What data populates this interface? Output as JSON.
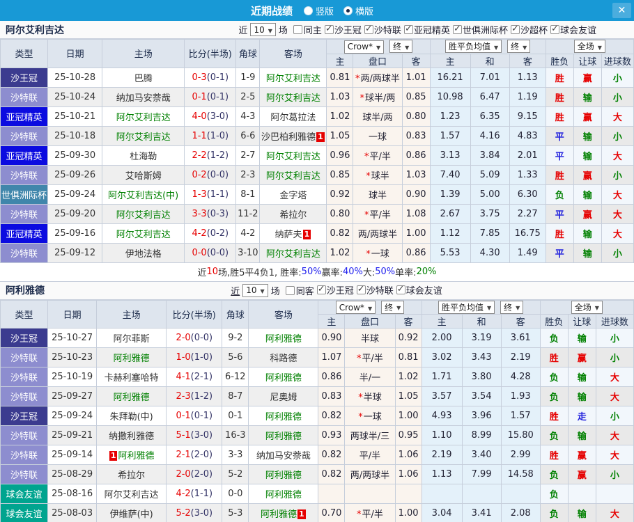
{
  "titlebar": {
    "title": "近期战绩",
    "radios": [
      {
        "label": "竖版",
        "selected": false
      },
      {
        "label": "横版",
        "selected": true
      }
    ],
    "close_icon": "✕",
    "bar_color": "#1899d6"
  },
  "type_colors": {
    "沙王冠": "#3b3b8f",
    "沙特联": "#8d8dcf",
    "亚冠精英": "#0b0be0",
    "世俱洲际杯": "#4086ab",
    "球会友谊": "#00a48f"
  },
  "value_colors": {
    "胜": "#e60000",
    "平": "#2222dd",
    "负": "#008000",
    "赢": "#e60000",
    "输": "#008000",
    "走": "#2222dd",
    "大": "#e60000",
    "小": "#008000"
  },
  "sections": [
    {
      "team": "阿尔艾利吉达",
      "filter": {
        "near": "近",
        "count": "10",
        "games": "场",
        "same": {
          "label": "同主",
          "checked": false
        },
        "leagues": [
          "沙王冠",
          "沙特联",
          "亚冠精英",
          "世俱洲际杯",
          "沙超杯",
          "球会友谊"
        ],
        "near_underline": false
      },
      "dropdowns": {
        "company": "Crow*",
        "final1": "终",
        "avg": "胜平负均值",
        "final2": "终",
        "scope": "全场"
      },
      "columns": [
        "类型",
        "日期",
        "主场",
        "比分(半场)",
        "角球",
        "客场",
        "主",
        "盘口",
        "客",
        "主",
        "和",
        "客",
        "胜负",
        "让球",
        "进球数"
      ],
      "rows": [
        {
          "type": "沙王冠",
          "date": "25-10-28",
          "home": {
            "name": "巴腾",
            "focus": false
          },
          "score": "0-3",
          "half": "(0-1)",
          "corner": "1-9",
          "away": {
            "name": "阿尔艾利吉达",
            "focus": true
          },
          "odds": {
            "h": "0.81",
            "star": true,
            "pan": "两/两球半",
            "a": "1.01"
          },
          "avg": [
            "16.21",
            "7.01",
            "1.13"
          ],
          "result": "胜",
          "hcp": "赢",
          "goals": "小"
        },
        {
          "type": "沙特联",
          "date": "25-10-24",
          "home": {
            "name": "纳加马安萘哉",
            "focus": false
          },
          "score": "0-1",
          "half": "(0-1)",
          "corner": "2-5",
          "away": {
            "name": "阿尔艾利吉达",
            "focus": true
          },
          "odds": {
            "h": "1.03",
            "star": true,
            "pan": "球半/两",
            "a": "0.85"
          },
          "avg": [
            "10.98",
            "6.47",
            "1.19"
          ],
          "result": "胜",
          "hcp": "输",
          "goals": "小"
        },
        {
          "type": "亚冠精英",
          "date": "25-10-21",
          "home": {
            "name": "阿尔艾利吉达",
            "focus": true
          },
          "score": "4-0",
          "half": "(3-0)",
          "corner": "4-3",
          "away": {
            "name": "阿尔葛拉法",
            "focus": false
          },
          "odds": {
            "h": "1.02",
            "star": false,
            "pan": "球半/两",
            "a": "0.80"
          },
          "avg": [
            "1.23",
            "6.35",
            "9.15"
          ],
          "result": "胜",
          "hcp": "赢",
          "goals": "大"
        },
        {
          "type": "沙特联",
          "date": "25-10-18",
          "home": {
            "name": "阿尔艾利吉达",
            "focus": true
          },
          "score": "1-1",
          "half": "(1-0)",
          "corner": "6-6",
          "away": {
            "name": "沙巴柏利雅德",
            "focus": false,
            "card_after": "1"
          },
          "odds": {
            "h": "1.05",
            "star": false,
            "pan": "一球",
            "a": "0.83"
          },
          "avg": [
            "1.57",
            "4.16",
            "4.83"
          ],
          "result": "平",
          "hcp": "输",
          "goals": "小"
        },
        {
          "type": "亚冠精英",
          "date": "25-09-30",
          "home": {
            "name": "杜海勒",
            "focus": false
          },
          "score": "2-2",
          "half": "(1-2)",
          "corner": "2-7",
          "away": {
            "name": "阿尔艾利吉达",
            "focus": true
          },
          "odds": {
            "h": "0.96",
            "star": true,
            "pan": "平/半",
            "a": "0.86"
          },
          "avg": [
            "3.13",
            "3.84",
            "2.01"
          ],
          "result": "平",
          "hcp": "输",
          "goals": "大"
        },
        {
          "type": "沙特联",
          "date": "25-09-26",
          "home": {
            "name": "艾哈斯姆",
            "focus": false
          },
          "score": "0-2",
          "half": "(0-0)",
          "corner": "2-3",
          "away": {
            "name": "阿尔艾利吉达",
            "focus": true
          },
          "odds": {
            "h": "0.85",
            "star": true,
            "pan": "球半",
            "a": "1.03"
          },
          "avg": [
            "7.40",
            "5.09",
            "1.33"
          ],
          "result": "胜",
          "hcp": "赢",
          "goals": "小"
        },
        {
          "type": "世俱洲际杯",
          "date": "25-09-24",
          "home": {
            "name": "阿尔艾利吉达(中)",
            "focus": true
          },
          "score": "1-3",
          "half": "(1-1)",
          "corner": "8-1",
          "away": {
            "name": "金字塔",
            "focus": false
          },
          "odds": {
            "h": "0.92",
            "star": false,
            "pan": "球半",
            "a": "0.90"
          },
          "avg": [
            "1.39",
            "5.00",
            "6.30"
          ],
          "result": "负",
          "hcp": "输",
          "goals": "大"
        },
        {
          "type": "沙特联",
          "date": "25-09-20",
          "home": {
            "name": "阿尔艾利吉达",
            "focus": true
          },
          "score": "3-3",
          "half": "(0-3)",
          "corner": "11-2",
          "away": {
            "name": "希拉尔",
            "focus": false
          },
          "odds": {
            "h": "0.80",
            "star": true,
            "pan": "平/半",
            "a": "1.08"
          },
          "avg": [
            "2.67",
            "3.75",
            "2.27"
          ],
          "result": "平",
          "hcp": "赢",
          "goals": "大"
        },
        {
          "type": "亚冠精英",
          "date": "25-09-16",
          "home": {
            "name": "阿尔艾利吉达",
            "focus": true
          },
          "score": "4-2",
          "half": "(0-2)",
          "corner": "4-2",
          "away": {
            "name": "纳萨夫",
            "focus": false,
            "card_after": "1"
          },
          "odds": {
            "h": "0.82",
            "star": false,
            "pan": "两/两球半",
            "a": "1.00"
          },
          "avg": [
            "1.12",
            "7.85",
            "16.75"
          ],
          "result": "胜",
          "hcp": "输",
          "goals": "大"
        },
        {
          "type": "沙特联",
          "date": "25-09-12",
          "home": {
            "name": "伊地法格",
            "focus": false
          },
          "score": "0-0",
          "half": "(0-0)",
          "corner": "3-10",
          "away": {
            "name": "阿尔艾利吉达",
            "focus": true
          },
          "odds": {
            "h": "1.02",
            "star": true,
            "pan": "一球",
            "a": "0.86"
          },
          "avg": [
            "5.53",
            "4.30",
            "1.49"
          ],
          "result": "平",
          "hcp": "输",
          "goals": "小"
        }
      ],
      "summary_parts": [
        {
          "text": "近",
          "color": "#333333"
        },
        {
          "text": "10",
          "color": "#e60000"
        },
        {
          "text": "场,胜5平4负1, 胜率:",
          "color": "#333333"
        },
        {
          "text": "50%",
          "color": "#2222ee"
        },
        {
          "text": " 赢率:",
          "color": "#333333"
        },
        {
          "text": "40%",
          "color": "#2222ee"
        },
        {
          "text": " 大:",
          "color": "#333333"
        },
        {
          "text": "50%",
          "color": "#2222ee"
        },
        {
          "text": " 单率:",
          "color": "#333333"
        },
        {
          "text": "20%",
          "color": "#008000"
        }
      ]
    },
    {
      "team": "阿利雅德",
      "filter": {
        "near": "近",
        "count": "10",
        "games": "场",
        "same": {
          "label": "同客",
          "checked": false
        },
        "leagues": [
          "沙王冠",
          "沙特联",
          "球会友谊"
        ],
        "near_underline": true
      },
      "dropdowns": {
        "company": "Crow*",
        "final1": "终",
        "avg": "胜平负均值",
        "final2": "终",
        "scope": "全场"
      },
      "columns": [
        "类型",
        "日期",
        "主场",
        "比分(半场)",
        "角球",
        "客场",
        "主",
        "盘口",
        "客",
        "主",
        "和",
        "客",
        "胜负",
        "让球",
        "进球数"
      ],
      "rows": [
        {
          "type": "沙王冠",
          "date": "25-10-27",
          "home": {
            "name": "阿尔菲斯",
            "focus": false
          },
          "score": "2-0",
          "half": "(0-0)",
          "corner": "9-2",
          "away": {
            "name": "阿利雅德",
            "focus": true
          },
          "odds": {
            "h": "0.90",
            "star": false,
            "pan": "半球",
            "a": "0.92"
          },
          "avg": [
            "2.00",
            "3.19",
            "3.61"
          ],
          "result": "负",
          "hcp": "输",
          "goals": "小"
        },
        {
          "type": "沙特联",
          "date": "25-10-23",
          "home": {
            "name": "阿利雅德",
            "focus": true
          },
          "score": "1-0",
          "half": "(1-0)",
          "corner": "5-6",
          "away": {
            "name": "科路德",
            "focus": false
          },
          "odds": {
            "h": "1.07",
            "star": true,
            "pan": "平/半",
            "a": "0.81"
          },
          "avg": [
            "3.02",
            "3.43",
            "2.19"
          ],
          "result": "胜",
          "hcp": "赢",
          "goals": "小"
        },
        {
          "type": "沙特联",
          "date": "25-10-19",
          "home": {
            "name": "卡赫利塞哈特",
            "focus": false
          },
          "score": "4-1",
          "half": "(2-1)",
          "corner": "6-12",
          "away": {
            "name": "阿利雅德",
            "focus": true
          },
          "odds": {
            "h": "0.86",
            "star": false,
            "pan": "半/一",
            "a": "1.02"
          },
          "avg": [
            "1.71",
            "3.80",
            "4.28"
          ],
          "result": "负",
          "hcp": "输",
          "goals": "大"
        },
        {
          "type": "沙特联",
          "date": "25-09-27",
          "home": {
            "name": "阿利雅德",
            "focus": true
          },
          "score": "2-3",
          "half": "(1-2)",
          "corner": "8-7",
          "away": {
            "name": "尼奥姆",
            "focus": false
          },
          "odds": {
            "h": "0.83",
            "star": true,
            "pan": "半球",
            "a": "1.05"
          },
          "avg": [
            "3.57",
            "3.54",
            "1.93"
          ],
          "result": "负",
          "hcp": "输",
          "goals": "大"
        },
        {
          "type": "沙王冠",
          "date": "25-09-24",
          "home": {
            "name": "朱拜勒(中)",
            "focus": false
          },
          "score": "0-1",
          "half": "(0-1)",
          "corner": "0-1",
          "away": {
            "name": "阿利雅德",
            "focus": true
          },
          "odds": {
            "h": "0.82",
            "star": true,
            "pan": "一球",
            "a": "1.00"
          },
          "avg": [
            "4.93",
            "3.96",
            "1.57"
          ],
          "result": "胜",
          "hcp": "走",
          "goals": "小"
        },
        {
          "type": "沙特联",
          "date": "25-09-21",
          "home": {
            "name": "纳撒利雅德",
            "focus": false
          },
          "score": "5-1",
          "half": "(3-0)",
          "corner": "16-3",
          "away": {
            "name": "阿利雅德",
            "focus": true
          },
          "odds": {
            "h": "0.93",
            "star": false,
            "pan": "两球半/三",
            "a": "0.95"
          },
          "avg": [
            "1.10",
            "8.99",
            "15.80"
          ],
          "result": "负",
          "hcp": "输",
          "goals": "大"
        },
        {
          "type": "沙特联",
          "date": "25-09-14",
          "home": {
            "name": "阿利雅德",
            "focus": true,
            "card_before": "1"
          },
          "score": "2-1",
          "half": "(2-0)",
          "corner": "3-3",
          "away": {
            "name": "纳加马安萘哉",
            "focus": false
          },
          "odds": {
            "h": "0.82",
            "star": false,
            "pan": "平/半",
            "a": "1.06"
          },
          "avg": [
            "2.19",
            "3.40",
            "2.99"
          ],
          "result": "胜",
          "hcp": "赢",
          "goals": "大"
        },
        {
          "type": "沙特联",
          "date": "25-08-29",
          "home": {
            "name": "希拉尔",
            "focus": false
          },
          "score": "2-0",
          "half": "(2-0)",
          "corner": "5-2",
          "away": {
            "name": "阿利雅德",
            "focus": true
          },
          "odds": {
            "h": "0.82",
            "star": false,
            "pan": "两/两球半",
            "a": "1.06"
          },
          "avg": [
            "1.13",
            "7.99",
            "14.58"
          ],
          "result": "负",
          "hcp": "赢",
          "goals": "小"
        },
        {
          "type": "球会友谊",
          "date": "25-08-16",
          "home": {
            "name": "阿尔艾利吉达",
            "focus": false
          },
          "score": "4-2",
          "half": "(1-1)",
          "corner": "0-0",
          "away": {
            "name": "阿利雅德",
            "focus": true
          },
          "odds": {
            "h": "",
            "star": false,
            "pan": "",
            "a": ""
          },
          "avg": [
            "",
            "",
            ""
          ],
          "result": "负",
          "hcp": "",
          "goals": ""
        },
        {
          "type": "球会友谊",
          "date": "25-08-03",
          "home": {
            "name": "伊维萨(中)",
            "focus": false
          },
          "score": "5-2",
          "half": "(3-0)",
          "corner": "5-3",
          "away": {
            "name": "阿利雅德",
            "focus": true,
            "card_after": "1"
          },
          "odds": {
            "h": "0.70",
            "star": true,
            "pan": "平/半",
            "a": "1.00"
          },
          "avg": [
            "3.04",
            "3.41",
            "2.08"
          ],
          "result": "负",
          "hcp": "输",
          "goals": "大"
        }
      ]
    }
  ]
}
